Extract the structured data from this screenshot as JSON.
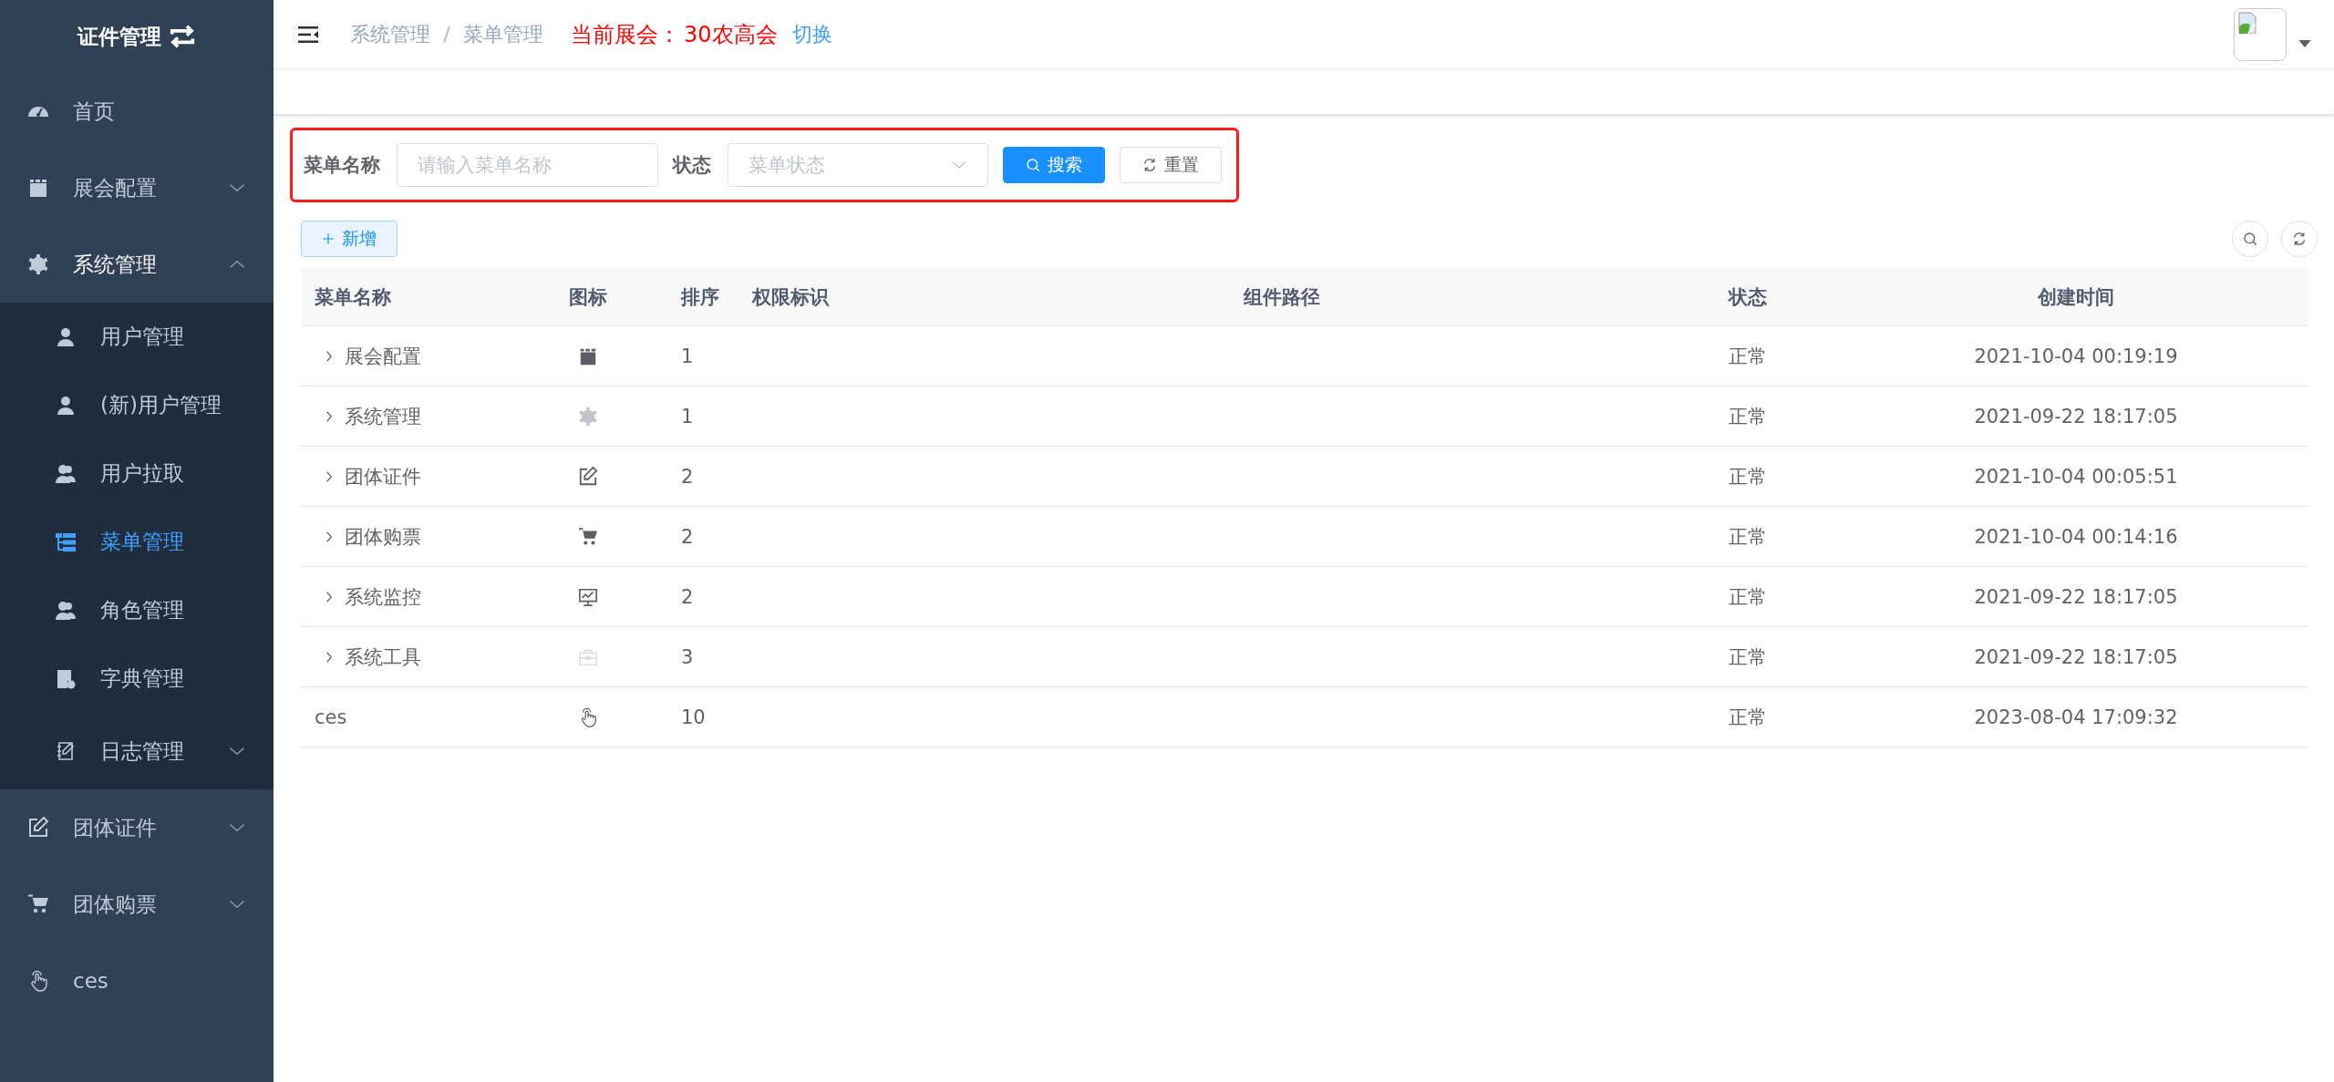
{
  "sidebar": {
    "title": "证件管理",
    "items": [
      {
        "label": "首页",
        "selected": false
      },
      {
        "label": "展会配置",
        "selected": false,
        "expanded": false
      },
      {
        "label": "系统管理",
        "selected": false,
        "expanded": true,
        "children": [
          {
            "label": "用户管理",
            "selected": false
          },
          {
            "label": "(新)用户管理",
            "selected": false
          },
          {
            "label": "用户拉取",
            "selected": false
          },
          {
            "label": "菜单管理",
            "selected": true
          },
          {
            "label": "角色管理",
            "selected": false
          },
          {
            "label": "字典管理",
            "selected": false
          },
          {
            "label": "日志管理",
            "selected": false,
            "expanded": false
          }
        ]
      },
      {
        "label": "团体证件",
        "selected": false,
        "expanded": false
      },
      {
        "label": "团体购票",
        "selected": false,
        "expanded": false
      },
      {
        "label": "ces",
        "selected": false
      }
    ]
  },
  "header": {
    "breadcrumb": [
      "系统管理",
      "菜单管理"
    ],
    "breadcrumb_separator": "/",
    "exhibition_label": "当前展会：",
    "exhibition_name": "30农高会",
    "switch_link": "切换"
  },
  "search_form": {
    "fields": [
      {
        "label": "菜单名称",
        "placeholder": "请输入菜单名称",
        "kind": "input"
      },
      {
        "label": "状态",
        "placeholder": "菜单状态",
        "kind": "select"
      }
    ],
    "buttons": [
      {
        "label": "搜索",
        "kind": "primary"
      },
      {
        "label": "重置",
        "kind": "default"
      }
    ]
  },
  "add_button": "新增",
  "table": {
    "columns": [
      "菜单名称",
      "图标",
      "排序",
      "权限标识",
      "组件路径",
      "状态",
      "创建时间"
    ],
    "rows": [
      {
        "name": "展会配置",
        "expandable": true,
        "order": "1",
        "status": "正常",
        "created": "2021-10-04 00:19:19"
      },
      {
        "name": "系统管理",
        "expandable": true,
        "order": "1",
        "status": "正常",
        "created": "2021-09-22 18:17:05"
      },
      {
        "name": "团体证件",
        "expandable": true,
        "order": "2",
        "status": "正常",
        "created": "2021-10-04 00:05:51"
      },
      {
        "name": "团体购票",
        "expandable": true,
        "order": "2",
        "status": "正常",
        "created": "2021-10-04 00:14:16"
      },
      {
        "name": "系统监控",
        "expandable": true,
        "order": "2",
        "status": "正常",
        "created": "2021-09-22 18:17:05"
      },
      {
        "name": "系统工具",
        "expandable": true,
        "order": "3",
        "status": "正常",
        "created": "2021-09-22 18:17:05"
      },
      {
        "name": "ces",
        "expandable": false,
        "order": "10",
        "status": "正常",
        "created": "2023-08-04 17:09:32"
      }
    ]
  }
}
